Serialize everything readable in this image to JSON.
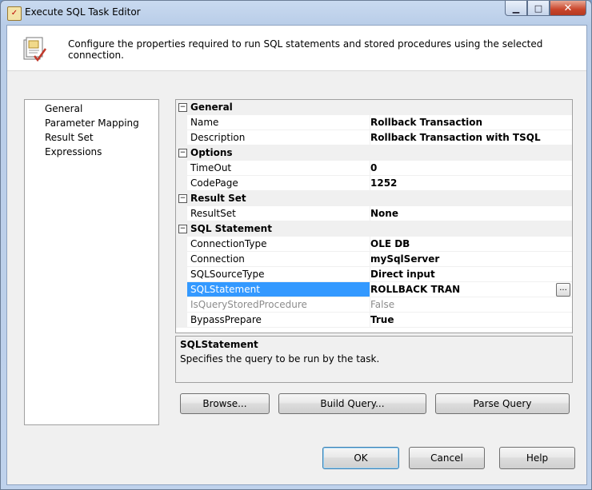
{
  "window": {
    "title": "Execute SQL Task Editor",
    "minimize_glyph": "▁",
    "maximize_glyph": "□",
    "close_glyph": "✕"
  },
  "header": {
    "text": "Configure the properties required to run SQL statements and stored procedures using the selected connection."
  },
  "nav": {
    "items": [
      "General",
      "Parameter Mapping",
      "Result Set",
      "Expressions"
    ],
    "selected": "General"
  },
  "grid": {
    "toggle_glyph": "−",
    "ellipsis_label": "...",
    "categories": [
      {
        "label": "General"
      },
      {
        "label": "Options"
      },
      {
        "label": "Result Set"
      },
      {
        "label": "SQL Statement"
      }
    ],
    "props": {
      "name": {
        "label": "Name",
        "value": "Rollback Transaction"
      },
      "description": {
        "label": "Description",
        "value": "Rollback Transaction with TSQL"
      },
      "timeout": {
        "label": "TimeOut",
        "value": "0"
      },
      "codepage": {
        "label": "CodePage",
        "value": "1252"
      },
      "resultset": {
        "label": "ResultSet",
        "value": "None"
      },
      "connectiontype": {
        "label": "ConnectionType",
        "value": "OLE DB"
      },
      "connection": {
        "label": "Connection",
        "value": "mySqlServer"
      },
      "sqlsourcetype": {
        "label": "SQLSourceType",
        "value": "Direct input"
      },
      "sqlstatement": {
        "label": "SQLStatement",
        "value": "ROLLBACK TRAN"
      },
      "isquerystoredprocedure": {
        "label": "IsQueryStoredProcedure",
        "value": "False"
      },
      "bypassprepare": {
        "label": "BypassPrepare",
        "value": "True"
      }
    },
    "selected_prop": "SQLStatement"
  },
  "description": {
    "title": "SQLStatement",
    "text": "Specifies the query to be run by the task."
  },
  "buttons": {
    "browse": "Browse...",
    "build_query": "Build Query...",
    "parse_query": "Parse Query",
    "ok": "OK",
    "cancel": "Cancel",
    "help": "Help"
  },
  "colors": {
    "selection": "#3399ff",
    "category_bg": "#f0f0f0",
    "disabled_text": "#8c8c8c"
  },
  "icons": {
    "title": "sql-task-icon",
    "header": "sql-task-large-icon",
    "ellipsis": "ellipsis-icon"
  }
}
